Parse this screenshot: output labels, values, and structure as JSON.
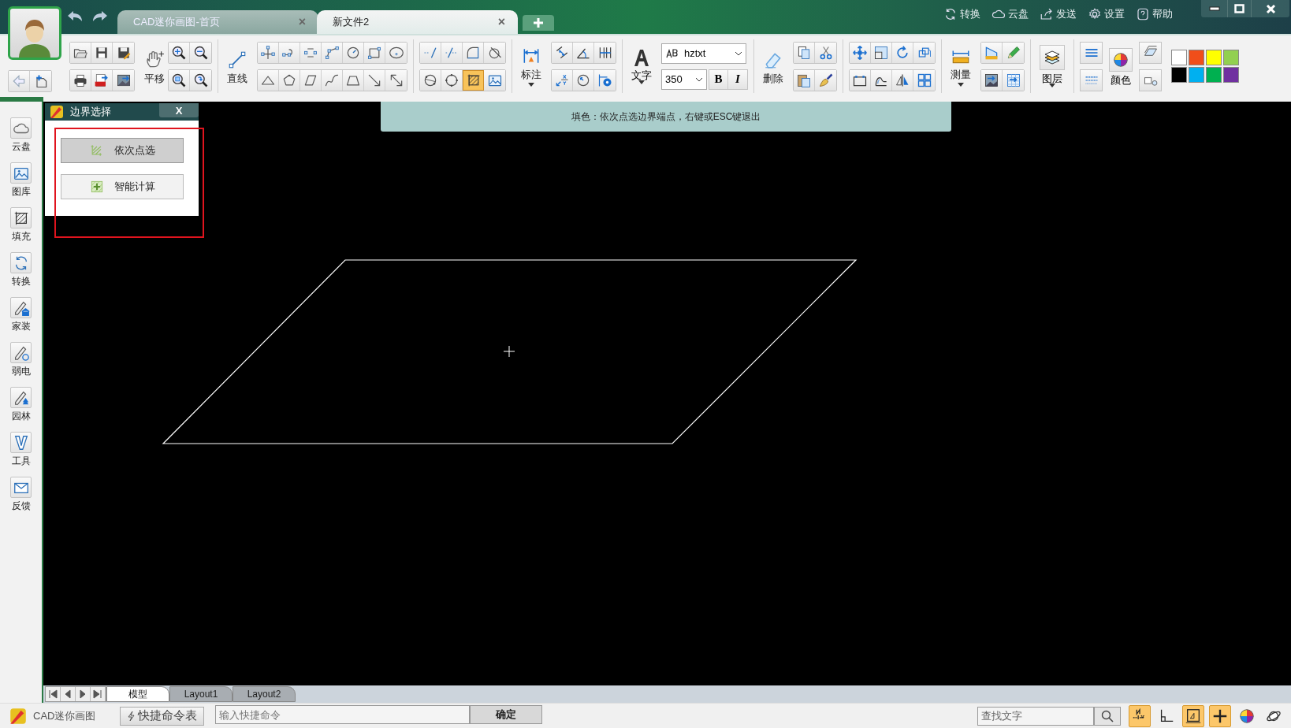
{
  "tabs": [
    {
      "label": "CAD迷你画图-首页",
      "close": "×",
      "selected": false
    },
    {
      "label": "新文件2",
      "close": "×",
      "selected": true
    }
  ],
  "top_links": [
    {
      "kind": "convert",
      "label": "转换"
    },
    {
      "kind": "cloud",
      "label": "云盘"
    },
    {
      "kind": "send",
      "label": "发送"
    },
    {
      "kind": "settings",
      "label": "设置"
    },
    {
      "kind": "help",
      "label": "帮助"
    }
  ],
  "toolbar": {
    "pan_label": "平移",
    "line_label": "直线",
    "dimension_label": "标注",
    "text_label": "文字",
    "font": "hztxt",
    "font_size": "350",
    "bold_button": "B",
    "italic_button": "I",
    "delete_label": "删除",
    "measure_label": "测量",
    "layer_label": "图层",
    "color_label": "颜色",
    "hatch_button": {
      "selected": true
    },
    "palette": [
      {
        "color": "#ffffff"
      },
      {
        "color": "#f04e1a"
      },
      {
        "color": "#ffff00"
      },
      {
        "color": "#92d050"
      },
      {
        "color": "#000000"
      },
      {
        "color": "#00b0f0"
      },
      {
        "color": "#00b050"
      },
      {
        "color": "#7030a0"
      }
    ]
  },
  "sidebar": [
    {
      "kind": "cloud",
      "label": "云盘"
    },
    {
      "kind": "gallery",
      "label": "图库"
    },
    {
      "kind": "hatch",
      "label": "填充"
    },
    {
      "kind": "convert",
      "label": "转换"
    },
    {
      "kind": "home",
      "label": "家装"
    },
    {
      "kind": "electric",
      "label": "弱电"
    },
    {
      "kind": "garden",
      "label": "园林"
    },
    {
      "kind": "tools",
      "label": "工具"
    },
    {
      "kind": "feedback",
      "label": "反馈"
    }
  ],
  "hint": "填色：依次点选边界端点，右键或ESC键退出",
  "dialog": {
    "title": "边界选择",
    "close": "X",
    "options": [
      {
        "label": "依次点选",
        "selected": true
      },
      {
        "label": "智能计算",
        "selected": false
      }
    ]
  },
  "layout_tabs": [
    {
      "label": "模型",
      "selected": true
    },
    {
      "label": "Layout1",
      "selected": false
    },
    {
      "label": "Layout2",
      "selected": false
    }
  ],
  "status_bar": {
    "app_name": "CAD迷你画图",
    "shortcut_button": "快捷命令表",
    "command_placeholder": "输入快捷命令",
    "confirm": "确定",
    "search_placeholder": "查找文字",
    "toggles": [
      {
        "kind": "snap",
        "on": true
      },
      {
        "kind": "ortho",
        "on": false
      },
      {
        "kind": "grid",
        "on": true
      },
      {
        "kind": "cross",
        "on": true
      },
      {
        "kind": "color",
        "on": false
      },
      {
        "kind": "orbit",
        "on": false
      }
    ]
  }
}
